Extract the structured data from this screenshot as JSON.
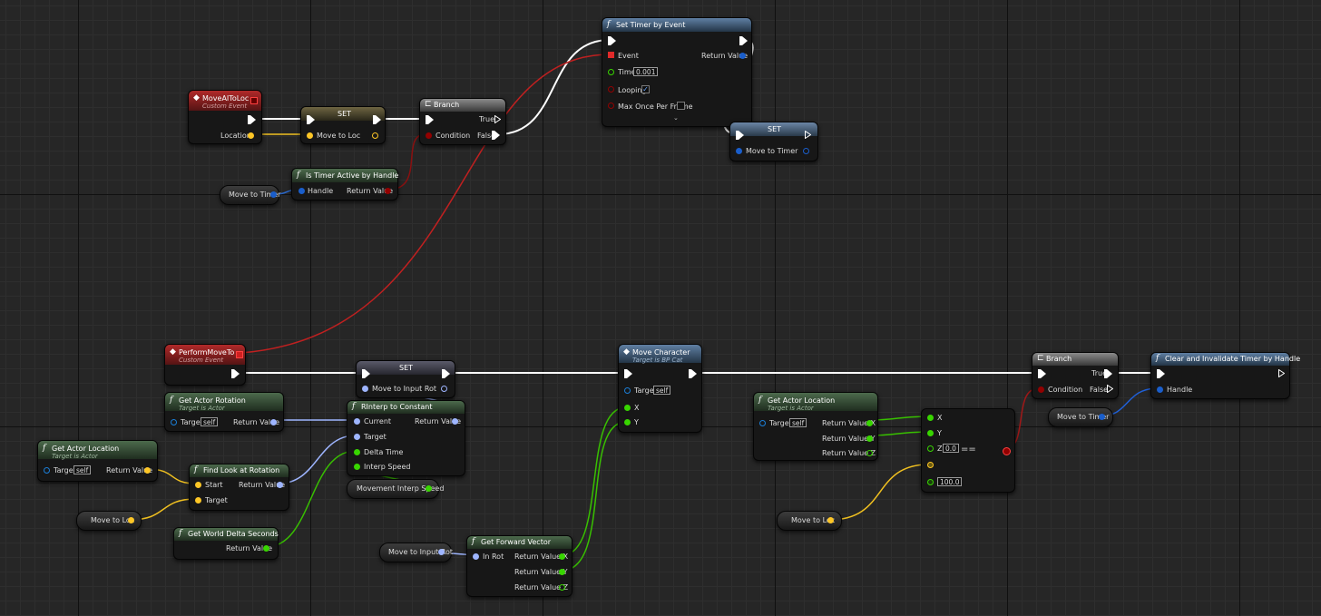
{
  "colors": {
    "exec": "#ffffff",
    "bool": "#920101",
    "vector": "#fdc626",
    "rotator": "#9eb5ff",
    "float": "#38d500",
    "object": "#1b7fd8",
    "handle": "#1a5ecb",
    "event": "#e12a2a"
  },
  "nodes": {
    "move_ai_to_loc": {
      "title": "MoveAIToLoc",
      "subtitle": "Custom Event",
      "out_location": "Location"
    },
    "set_loc": {
      "title": "SET",
      "in_move_to_loc": "Move to Loc"
    },
    "branch_top": {
      "title": "Branch",
      "in_condition": "Condition",
      "out_true": "True",
      "out_false": "False"
    },
    "is_timer_active": {
      "title": "Is Timer Active by Handle",
      "in_handle": "Handle",
      "out_return": "Return Value"
    },
    "var_move_to_timer_1": {
      "label": "Move to Timer"
    },
    "set_timer": {
      "title": "Set Timer by Event",
      "in_event": "Event",
      "in_time": "Time",
      "time_value": "0.001",
      "in_looping": "Looping",
      "looping_checked": true,
      "in_max_once": "Max Once Per Frame",
      "out_return": "Return Value"
    },
    "set_timer_var": {
      "title": "SET",
      "in_move_to_timer": "Move to Timer"
    },
    "perform_move_to": {
      "title": "PerformMoveTo",
      "subtitle": "Custom Event"
    },
    "set_rot": {
      "title": "SET",
      "in_move_to_input_rot": "Move to Input Rot"
    },
    "get_actor_rotation": {
      "title": "Get Actor Rotation",
      "subtitle": "Target is Actor",
      "in_target": "Target",
      "target_value": "self",
      "out_return": "Return Value"
    },
    "rinterp": {
      "title": "RInterp to Constant",
      "in_current": "Current",
      "in_target": "Target",
      "in_delta": "Delta Time",
      "in_speed": "Interp Speed",
      "out_return": "Return Value"
    },
    "var_interp_speed": {
      "label": "Movement Interp Speed"
    },
    "get_actor_location_1": {
      "title": "Get Actor Location",
      "subtitle": "Target is Actor",
      "in_target": "Target",
      "target_value": "self",
      "out_return": "Return Value"
    },
    "find_look_at": {
      "title": "Find Look at Rotation",
      "in_start": "Start",
      "in_target": "Target",
      "out_return": "Return Value"
    },
    "var_move_to_loc_1": {
      "label": "Move to Loc"
    },
    "get_world_delta": {
      "title": "Get World Delta Seconds",
      "out_return": "Return Value"
    },
    "move_character": {
      "title": "Move Character",
      "subtitle": "Target is BP Cat",
      "in_target": "Target",
      "target_value": "self",
      "in_x": "X",
      "in_y": "Y"
    },
    "var_move_to_input_rot": {
      "label": "Move to Input Rot"
    },
    "get_forward_vector": {
      "title": "Get Forward Vector",
      "in_rot": "In Rot",
      "out_x": "Return Value X",
      "out_y": "Return Value Y",
      "out_z": "Return Value Z"
    },
    "get_actor_location_2": {
      "title": "Get Actor Location",
      "subtitle": "Target is Actor",
      "in_target": "Target",
      "target_value": "self",
      "out_x": "Return Value X",
      "out_y": "Return Value Y",
      "out_z": "Return Value Z"
    },
    "make_vector_eq": {
      "in_x": "X",
      "in_y": "Y",
      "in_z": "Z",
      "z_value": "0.0",
      "op": "==",
      "tolerance": "100.0"
    },
    "var_move_to_loc_2": {
      "label": "Move to Loc"
    },
    "branch_bottom": {
      "title": "Branch",
      "in_condition": "Condition",
      "out_true": "True",
      "out_false": "False"
    },
    "clear_timer": {
      "title": "Clear and Invalidate Timer by Handle",
      "in_handle": "Handle"
    },
    "var_move_to_timer_2": {
      "label": "Move to Timer"
    }
  }
}
